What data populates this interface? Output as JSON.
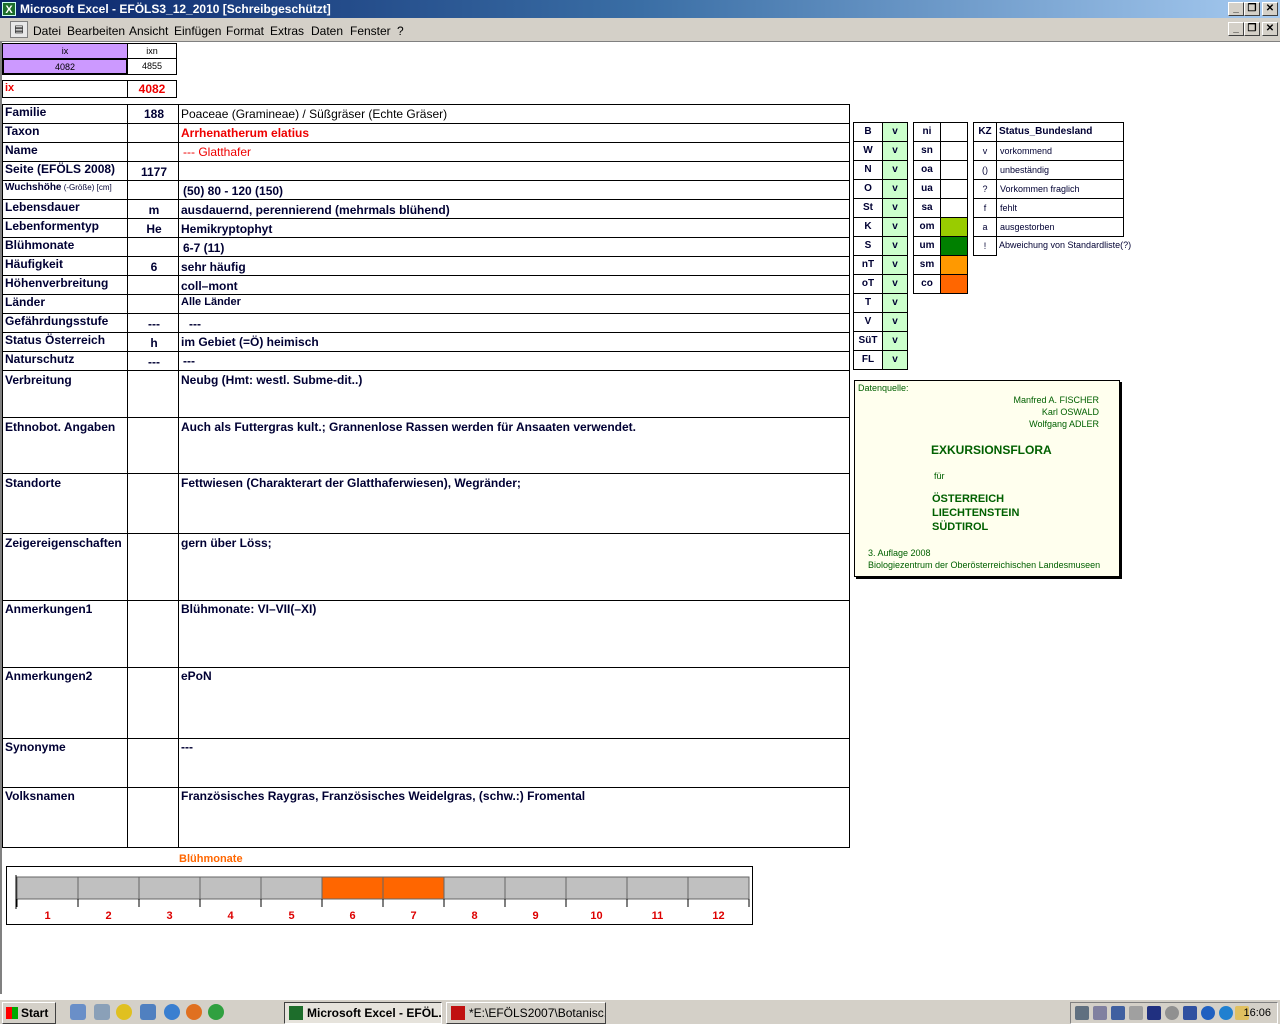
{
  "window": {
    "title": "Microsoft Excel - EFÖLS3_12_2010  [Schreibgeschützt]",
    "min_label": "_",
    "max_label": "❐",
    "close_label": "✕"
  },
  "menu": [
    {
      "label": "Datei"
    },
    {
      "label": "Bearbeiten"
    },
    {
      "label": "Ansicht"
    },
    {
      "label": "Einfügen"
    },
    {
      "label": "Format"
    },
    {
      "label": "Extras"
    },
    {
      "label": "Daten"
    },
    {
      "label": "Fenster"
    },
    {
      "label": "?"
    }
  ],
  "index": {
    "ix_header": "ix",
    "ixn_header": "ixn",
    "ix_value": "4082",
    "ixn_value": "4855",
    "ix_label": "ix",
    "ix_big": "4082"
  },
  "record": {
    "familie": {
      "label": "Familie",
      "code": "188",
      "value": "Poaceae (Gramineae)  /  Süßgräser (Echte Gräser)"
    },
    "taxon": {
      "label": "Taxon",
      "value": "Arrhenatherum elatius"
    },
    "name": {
      "label": "Name",
      "value": "--- Glatthafer"
    },
    "seite": {
      "label": "Seite (EFÖLS 2008)",
      "code": "1177"
    },
    "wuchshoehe": {
      "label": "Wuchshöhe",
      "label_small": " (-Größe) [cm]",
      "value": "(50) 80 - 120 (150)"
    },
    "lebensdauer": {
      "label": "Lebensdauer",
      "code": "m",
      "value": "ausdauernd, perennierend (mehrmals blühend)"
    },
    "lebensformentyp": {
      "label": "Lebenformentyp",
      "code": "He",
      "value": "Hemikryptophyt"
    },
    "bluehmonate": {
      "label": "Blühmonate",
      "value": "6-7 (11)"
    },
    "haeufigkeit": {
      "label": "Häufigkeit",
      "code": "6",
      "value": "sehr häufig"
    },
    "hoehenverbreitung": {
      "label": "Höhenverbreitung",
      "value": "coll–mont"
    },
    "laender": {
      "label": "Länder",
      "value": "Alle Länder"
    },
    "gefaehrdung": {
      "label": "Gefährdungsstufe",
      "code": "---",
      "value": "---"
    },
    "status_oe": {
      "label": "Status Österreich",
      "code": "h",
      "value": "im Gebiet (=Ö) heimisch"
    },
    "naturschutz": {
      "label": "Naturschutz",
      "code": "---",
      "value": "---"
    },
    "verbreitung": {
      "label": "Verbreitung",
      "value": "Neubg (Hmt: westl. Subme-dit..)"
    },
    "ethnobot": {
      "label": "Ethnobot. Angaben",
      "value": "Auch als Futtergras kult.; Grannenlose Rassen werden für Ansaaten verwendet."
    },
    "standorte": {
      "label": "Standorte",
      "value": "Fettwiesen (Charakterart der Glatthaferwiesen), Wegränder;"
    },
    "zeiger": {
      "label": "Zeigereigenschaften",
      "value": "gern über Löss;"
    },
    "anm1": {
      "label": "Anmerkungen1",
      "value": "Blühmonate: VI–VII(–XI)"
    },
    "anm2": {
      "label": "Anmerkungen2",
      "value": "ePoN"
    },
    "synonyme": {
      "label": "Synonyme",
      "value": "---"
    },
    "volksnamen": {
      "label": "Volksnamen",
      "value": "Französisches Raygras,  Französisches Weidelgras, (schw.:) Fromental"
    }
  },
  "laender_table": [
    {
      "code": "B",
      "val": "v"
    },
    {
      "code": "W",
      "val": "v"
    },
    {
      "code": "N",
      "val": "v"
    },
    {
      "code": "O",
      "val": "v"
    },
    {
      "code": "St",
      "val": "v"
    },
    {
      "code": "K",
      "val": "v"
    },
    {
      "code": "S",
      "val": "v"
    },
    {
      "code": "nT",
      "val": "v"
    },
    {
      "code": "oT",
      "val": "v"
    },
    {
      "code": "T",
      "val": "v"
    },
    {
      "code": "V",
      "val": "v"
    },
    {
      "code": "SüT",
      "val": "v"
    },
    {
      "code": "FL",
      "val": "v"
    }
  ],
  "hoehen_table": [
    {
      "code": "ni",
      "color": "#ffffff"
    },
    {
      "code": "sn",
      "color": "#ffffff"
    },
    {
      "code": "oa",
      "color": "#ffffff"
    },
    {
      "code": "ua",
      "color": "#ffffff"
    },
    {
      "code": "sa",
      "color": "#ffffff"
    },
    {
      "code": "om",
      "color": "#99cc00"
    },
    {
      "code": "um",
      "color": "#008000"
    },
    {
      "code": "sm",
      "color": "#ff9900"
    },
    {
      "code": "co",
      "color": "#ff6600"
    }
  ],
  "status_legend": {
    "header_kz": "KZ",
    "header_label": "Status_Bundesland",
    "rows": [
      {
        "kz": "v",
        "text": "vorkommend"
      },
      {
        "kz": "()",
        "text": "unbeständig"
      },
      {
        "kz": "?",
        "text": "Vorkommen fraglich"
      },
      {
        "kz": "f",
        "text": "fehlt"
      },
      {
        "kz": "a",
        "text": "ausgestorben"
      },
      {
        "kz": "!",
        "text": "Abweichung von Standardliste(?)"
      }
    ]
  },
  "source": {
    "label": "Datenquelle:",
    "author1": "Manfred A. FISCHER",
    "author2": "Karl OSWALD",
    "author3": "Wolfgang ADLER",
    "title": "EXKURSIONSFLORA",
    "fuer": "für",
    "country1": "ÖSTERREICH",
    "country2": "LIECHTENSTEIN",
    "country3": "SÜDTIROL",
    "edition": "3. Auflage 2008",
    "publisher": "Biologiezentrum der Oberösterreichischen Landesmuseen"
  },
  "chart_data": {
    "type": "bar",
    "title": "Blühmonate",
    "categories": [
      "1",
      "2",
      "3",
      "4",
      "5",
      "6",
      "7",
      "8",
      "9",
      "10",
      "11",
      "12"
    ],
    "values": [
      0,
      0,
      0,
      0,
      0,
      1,
      1,
      0,
      0,
      0,
      0,
      0
    ],
    "colors": {
      "active": "#ff6600",
      "inactive": "#c0c0c0"
    }
  },
  "taskbar": {
    "start": "Start",
    "task1": "Microsoft Excel - EFÖL...",
    "task2": "*E:\\EFÖLS2007\\Botanisc...",
    "clock": "16:06"
  }
}
